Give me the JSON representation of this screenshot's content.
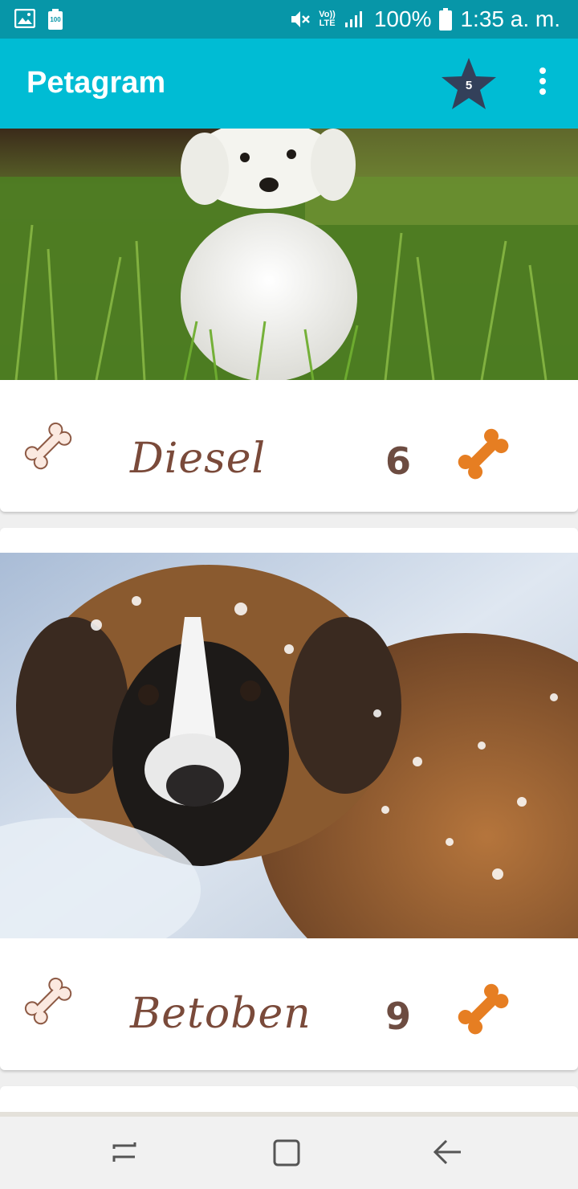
{
  "status_bar": {
    "left_icons": [
      "image-icon",
      "battery-saver-icon"
    ],
    "battery_saver_label": "100",
    "volte_top": "Vo))",
    "volte_bottom": "LTE",
    "battery_percent": "100%",
    "time": "1:35 a. m."
  },
  "app_bar": {
    "title": "Petagram",
    "favorites_count": "5",
    "favorites_icon": "star-icon",
    "menu_icon": "more-vert-icon",
    "colors": {
      "primary": "#00bcd4",
      "primary_dark": "#0796a8",
      "star": "#33405a"
    }
  },
  "pets": [
    {
      "name": "Diesel",
      "likes": "6",
      "photo": "white-maltese-puppy-in-grass"
    },
    {
      "name": "Betoben",
      "likes": "9",
      "photo": "saint-bernard-in-snow"
    }
  ],
  "colors": {
    "like_bone": "#fbe9e0",
    "rate_bone": "#e67e22",
    "name_text": "#7a4a3a"
  },
  "nav_bar": {
    "buttons": [
      "recent-apps-icon",
      "home-icon",
      "back-icon"
    ]
  }
}
